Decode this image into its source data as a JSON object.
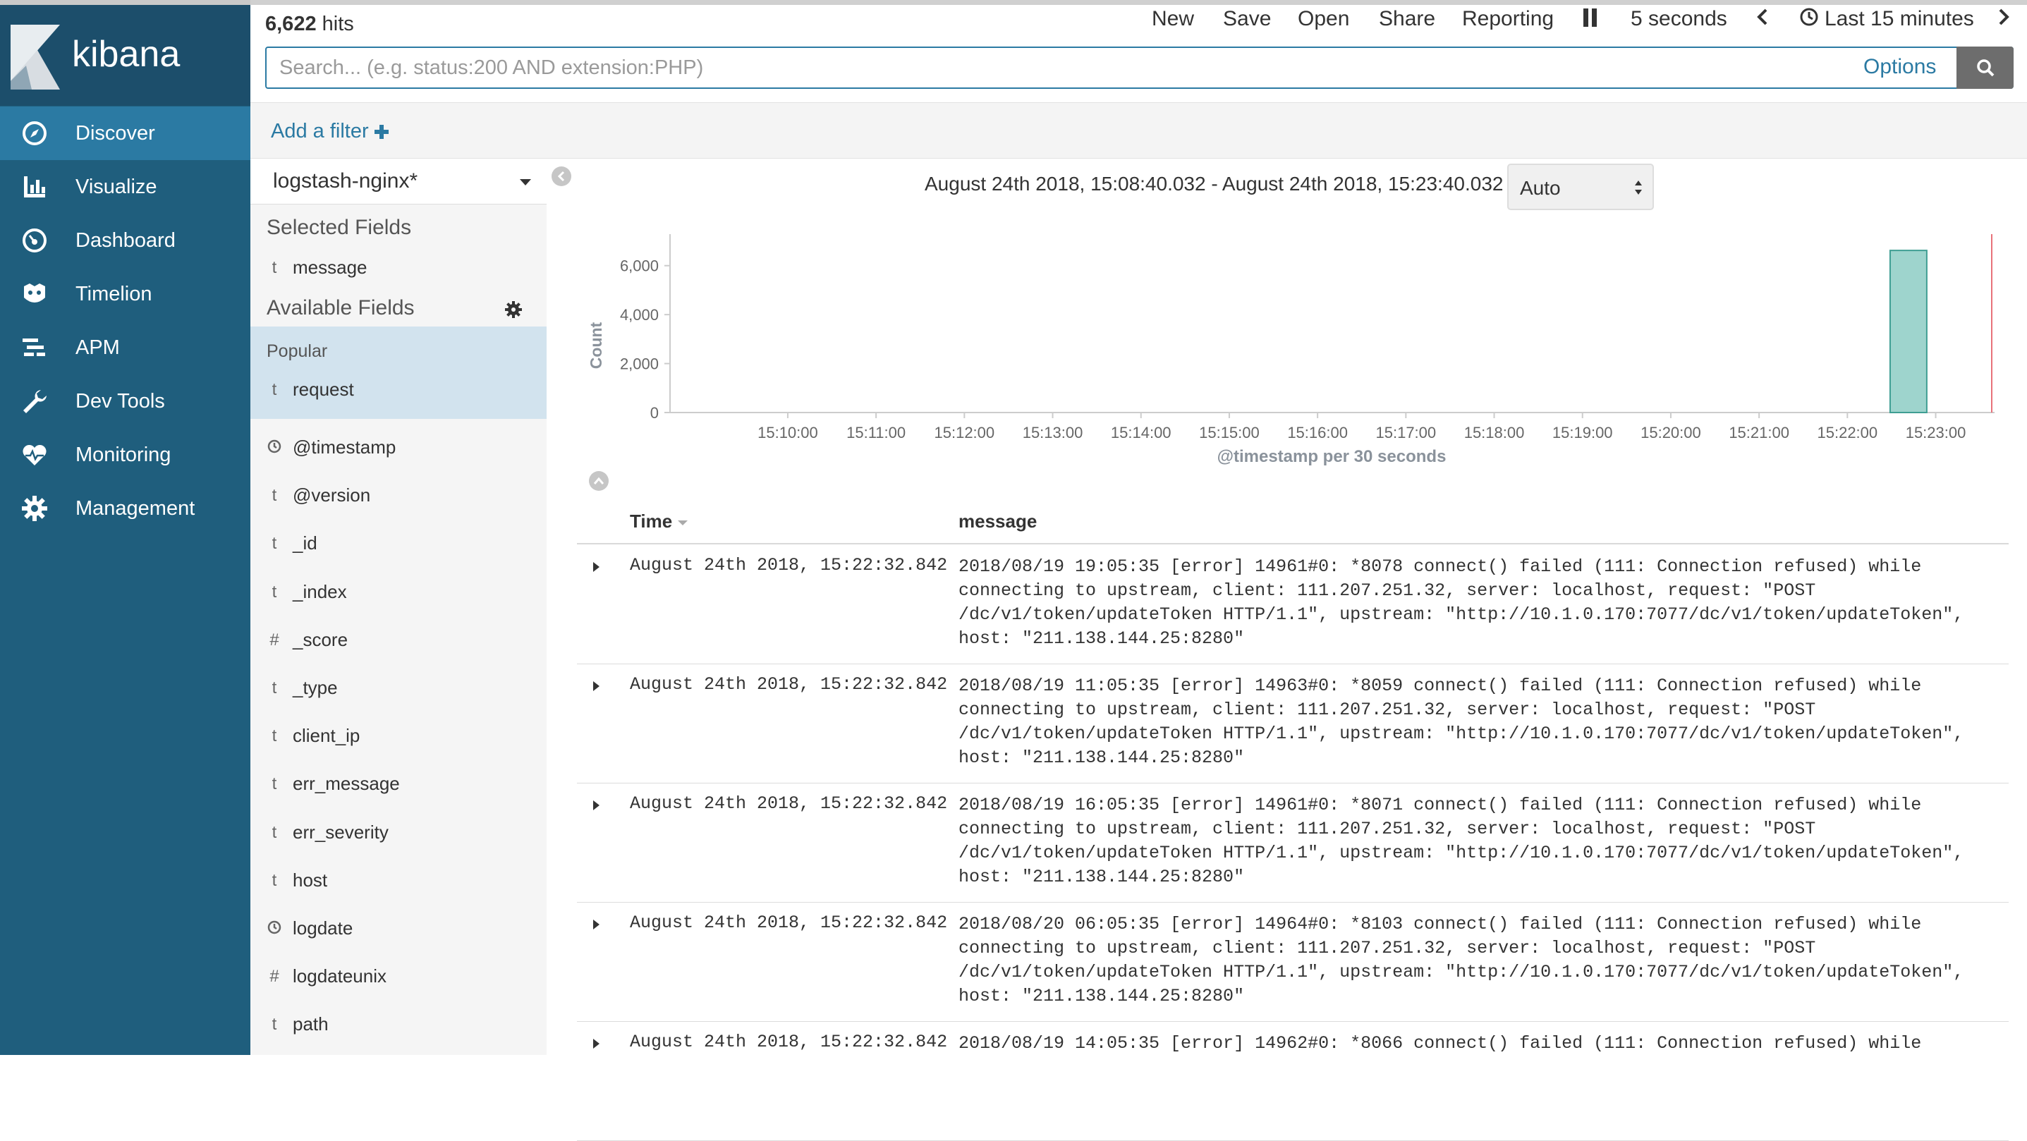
{
  "app": {
    "name": "kibana"
  },
  "nav": {
    "items": [
      {
        "label": "Discover",
        "icon": "compass-icon",
        "active": true
      },
      {
        "label": "Visualize",
        "icon": "bar-chart-icon",
        "active": false
      },
      {
        "label": "Dashboard",
        "icon": "dashboard-icon",
        "active": false
      },
      {
        "label": "Timelion",
        "icon": "timelion-icon",
        "active": false
      },
      {
        "label": "APM",
        "icon": "apm-icon",
        "active": false
      },
      {
        "label": "Dev Tools",
        "icon": "wrench-icon",
        "active": false
      },
      {
        "label": "Monitoring",
        "icon": "heartbeat-icon",
        "active": false
      },
      {
        "label": "Management",
        "icon": "gear-icon",
        "active": false
      }
    ]
  },
  "topbar": {
    "hits_count": "6,622",
    "hits_label": " hits",
    "menu": {
      "new": "New",
      "save": "Save",
      "open": "Open",
      "share": "Share",
      "reporting": "Reporting"
    },
    "refresh_interval": "5 seconds",
    "time_picker": "Last 15 minutes"
  },
  "search": {
    "placeholder": "Search... (e.g. status:200 AND extension:PHP)",
    "value": "",
    "options_label": "Options"
  },
  "filter": {
    "add_label": "Add a filter"
  },
  "sidebar": {
    "index_pattern": "logstash-nginx*",
    "selected_title": "Selected Fields",
    "selected_fields": [
      {
        "type": "t",
        "name": "message"
      }
    ],
    "available_title": "Available Fields",
    "popular_title": "Popular",
    "popular_fields": [
      {
        "type": "t",
        "name": "request"
      }
    ],
    "fields": [
      {
        "type": "clock",
        "name": "@timestamp"
      },
      {
        "type": "t",
        "name": "@version"
      },
      {
        "type": "t",
        "name": "_id"
      },
      {
        "type": "t",
        "name": "_index"
      },
      {
        "type": "#",
        "name": "_score"
      },
      {
        "type": "t",
        "name": "_type"
      },
      {
        "type": "t",
        "name": "client_ip"
      },
      {
        "type": "t",
        "name": "err_message"
      },
      {
        "type": "t",
        "name": "err_severity"
      },
      {
        "type": "t",
        "name": "host"
      },
      {
        "type": "clock",
        "name": "logdate"
      },
      {
        "type": "#",
        "name": "logdateunix"
      },
      {
        "type": "t",
        "name": "path"
      }
    ]
  },
  "histogram": {
    "time_range": "August 24th 2018, 15:08:40.032 - August 24th 2018, 15:23:40.032 —",
    "interval_value": "Auto"
  },
  "chart_data": {
    "type": "bar",
    "title": "",
    "ylabel": "Count",
    "xlabel": "@timestamp per 30 seconds",
    "ylim": [
      0,
      7000
    ],
    "yticks": [
      0,
      2000,
      4000,
      6000
    ],
    "ytick_labels": [
      "0",
      "2,000",
      "4,000",
      "6,000"
    ],
    "x_tick_labels": [
      "15:10:00",
      "15:11:00",
      "15:12:00",
      "15:13:00",
      "15:14:00",
      "15:15:00",
      "15:16:00",
      "15:17:00",
      "15:18:00",
      "15:19:00",
      "15:20:00",
      "15:21:00",
      "15:22:00",
      "15:23:00"
    ],
    "bars": [
      {
        "x": "15:22:30",
        "value": 6622
      }
    ],
    "now_marker": "15:23:40",
    "bar_color": "#9ed4cd",
    "bar_border": "#3f9e93",
    "marker_color": "#e8727a"
  },
  "table": {
    "columns": [
      "Time",
      "message"
    ],
    "rows": [
      {
        "time": "August 24th 2018, 15:22:32.842",
        "message": "2018/08/19 19:05:35 [error] 14961#0: *8078 connect() failed (111: Connection refused) while connecting to upstream, client: 111.207.251.32, server: localhost, request: \"POST /dc/v1/token/updateToken HTTP/1.1\", upstream: \"http://10.1.0.170:7077/dc/v1/token/updateToken\", host: \"211.138.144.25:8280\""
      },
      {
        "time": "August 24th 2018, 15:22:32.842",
        "message": "2018/08/19 11:05:35 [error] 14963#0: *8059 connect() failed (111: Connection refused) while connecting to upstream, client: 111.207.251.32, server: localhost, request: \"POST /dc/v1/token/updateToken HTTP/1.1\", upstream: \"http://10.1.0.170:7077/dc/v1/token/updateToken\", host: \"211.138.144.25:8280\""
      },
      {
        "time": "August 24th 2018, 15:22:32.842",
        "message": "2018/08/19 16:05:35 [error] 14961#0: *8071 connect() failed (111: Connection refused) while connecting to upstream, client: 111.207.251.32, server: localhost, request: \"POST /dc/v1/token/updateToken HTTP/1.1\", upstream: \"http://10.1.0.170:7077/dc/v1/token/updateToken\", host: \"211.138.144.25:8280\""
      },
      {
        "time": "August 24th 2018, 15:22:32.842",
        "message": "2018/08/20 06:05:35 [error] 14964#0: *8103 connect() failed (111: Connection refused) while connecting to upstream, client: 111.207.251.32, server: localhost, request: \"POST /dc/v1/token/updateToken HTTP/1.1\", upstream: \"http://10.1.0.170:7077/dc/v1/token/updateToken\", host: \"211.138.144.25:8280\""
      },
      {
        "time": "August 24th 2018, 15:22:32.842",
        "message": "2018/08/19 14:05:35 [error] 14962#0: *8066 connect() failed (111: Connection refused) while"
      }
    ]
  }
}
